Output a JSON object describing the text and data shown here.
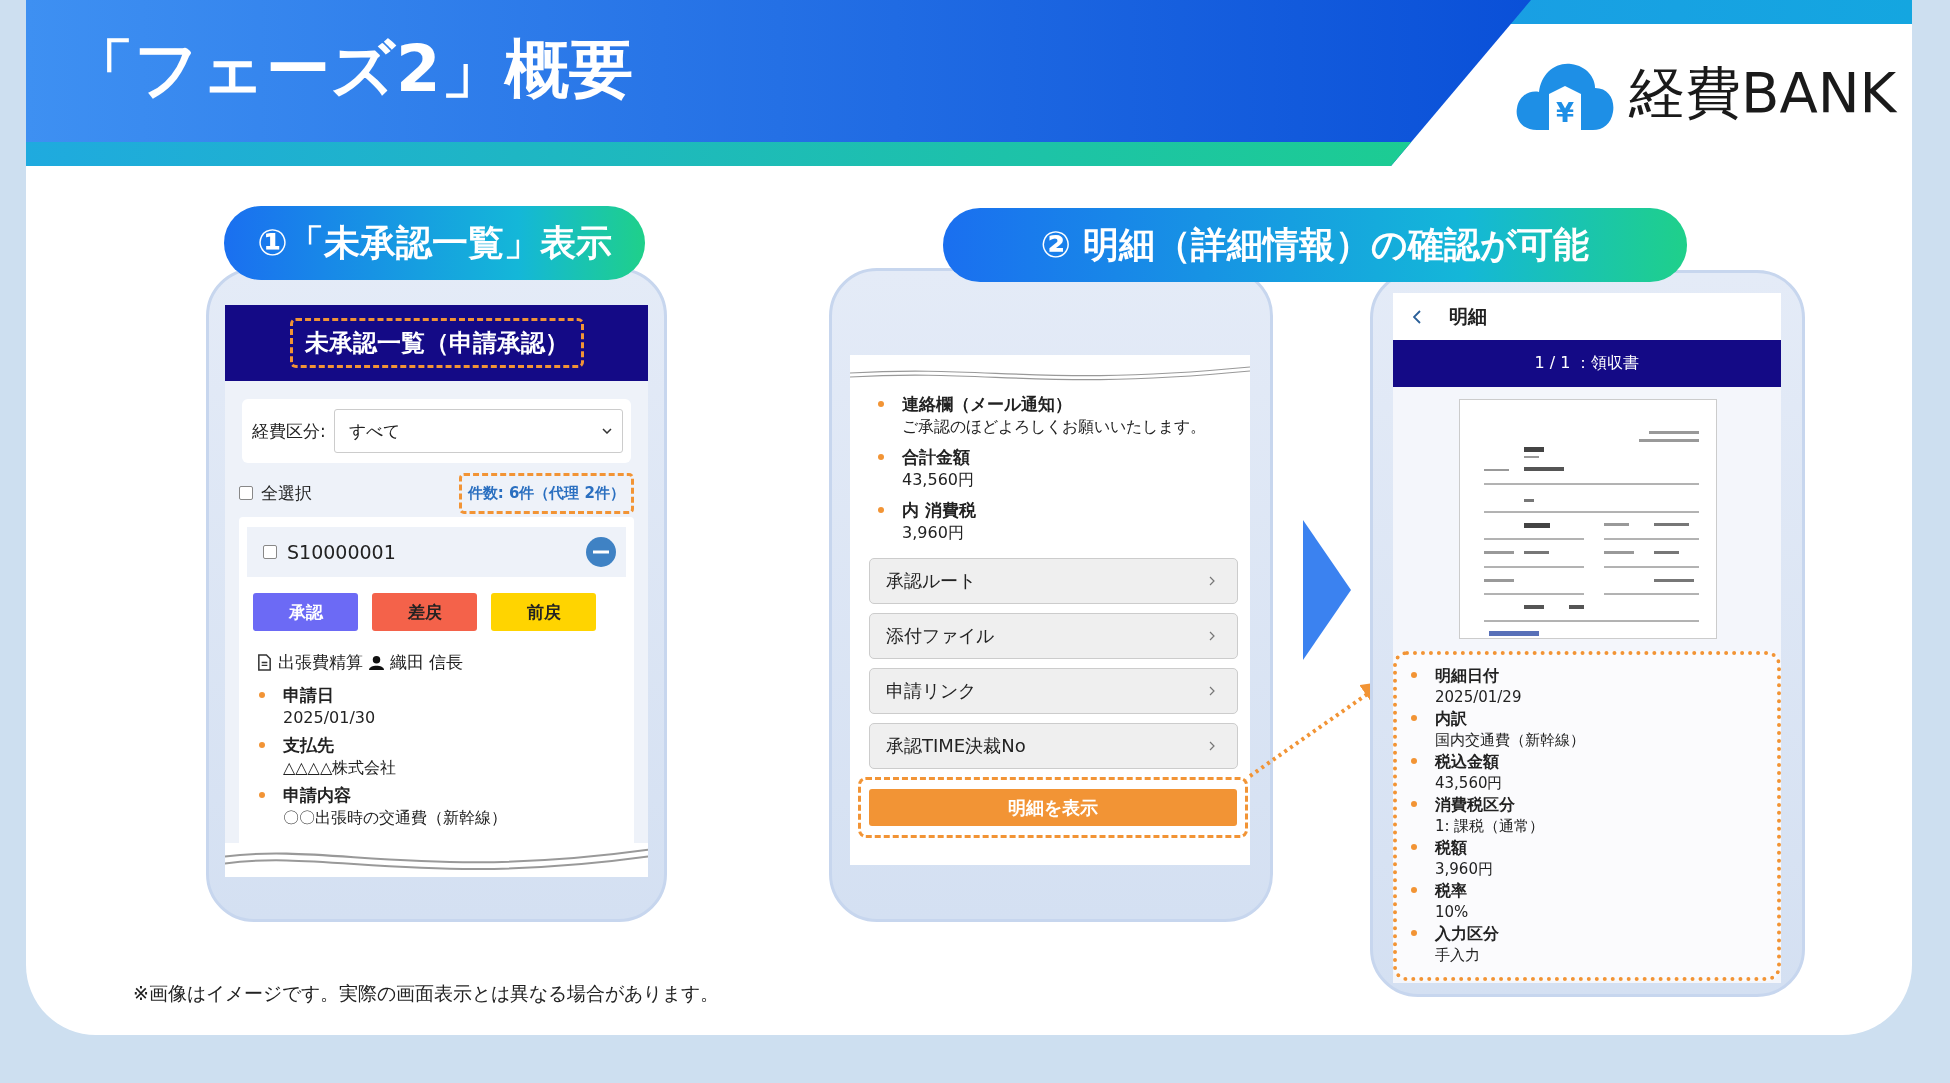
{
  "title": "「フェーズ2」概要",
  "logo": {
    "mark": "¥",
    "text": "経費BANK"
  },
  "steps": [
    {
      "label": "①「未承認一覧」表示"
    },
    {
      "label": "② 明細（詳細情報）の確認が可能"
    }
  ],
  "list_screen": {
    "header": "未承認一覧（申請承認）",
    "filter": {
      "label": "経費区分:",
      "value": "すべて"
    },
    "select_all": {
      "label": "全選択",
      "checked": false
    },
    "count": "件数: 6件（代理 2件）",
    "item": {
      "id": "S10000001",
      "checked": false,
      "type": "出張費精算",
      "applicant": "織田 信長",
      "buttons": [
        {
          "label": "承認",
          "kind": "approve"
        },
        {
          "label": "差戻",
          "kind": "remand"
        },
        {
          "label": "前戻",
          "kind": "back"
        }
      ],
      "fields": [
        {
          "label": "申請日",
          "value": "2025/01/30"
        },
        {
          "label": "支払先",
          "value": "△△△△株式会社"
        },
        {
          "label": "申請内容",
          "value": "〇〇出張時の交通費（新幹線）"
        }
      ]
    }
  },
  "detail_screen": {
    "fields": [
      {
        "label": "連絡欄（メール通知）",
        "value": "ご承認のほどよろしくお願いいたします。"
      },
      {
        "label": "合計金額",
        "value": "43,560円"
      },
      {
        "label": "内 消費税",
        "value": "3,960円"
      }
    ],
    "links": [
      "承認ルート",
      "添付ファイル",
      "申請リンク",
      "承認TIME決裁No"
    ],
    "button": "明細を表示"
  },
  "statement_screen": {
    "title": "明細",
    "banner": "1 / 1 ：領収書",
    "fields": [
      {
        "label": "明細日付",
        "value": "2025/01/29"
      },
      {
        "label": "内訳",
        "value": "国内交通費（新幹線）"
      },
      {
        "label": "税込金額",
        "value": "43,560円"
      },
      {
        "label": "消費税区分",
        "value": "1: 課税（通常）"
      },
      {
        "label": "税額",
        "value": "3,960円"
      },
      {
        "label": "税率",
        "value": "10%"
      },
      {
        "label": "入力区分",
        "value": "手入力"
      }
    ]
  },
  "footnote": "※画像はイメージです。実際の画面表示とは異なる場合があります。"
}
